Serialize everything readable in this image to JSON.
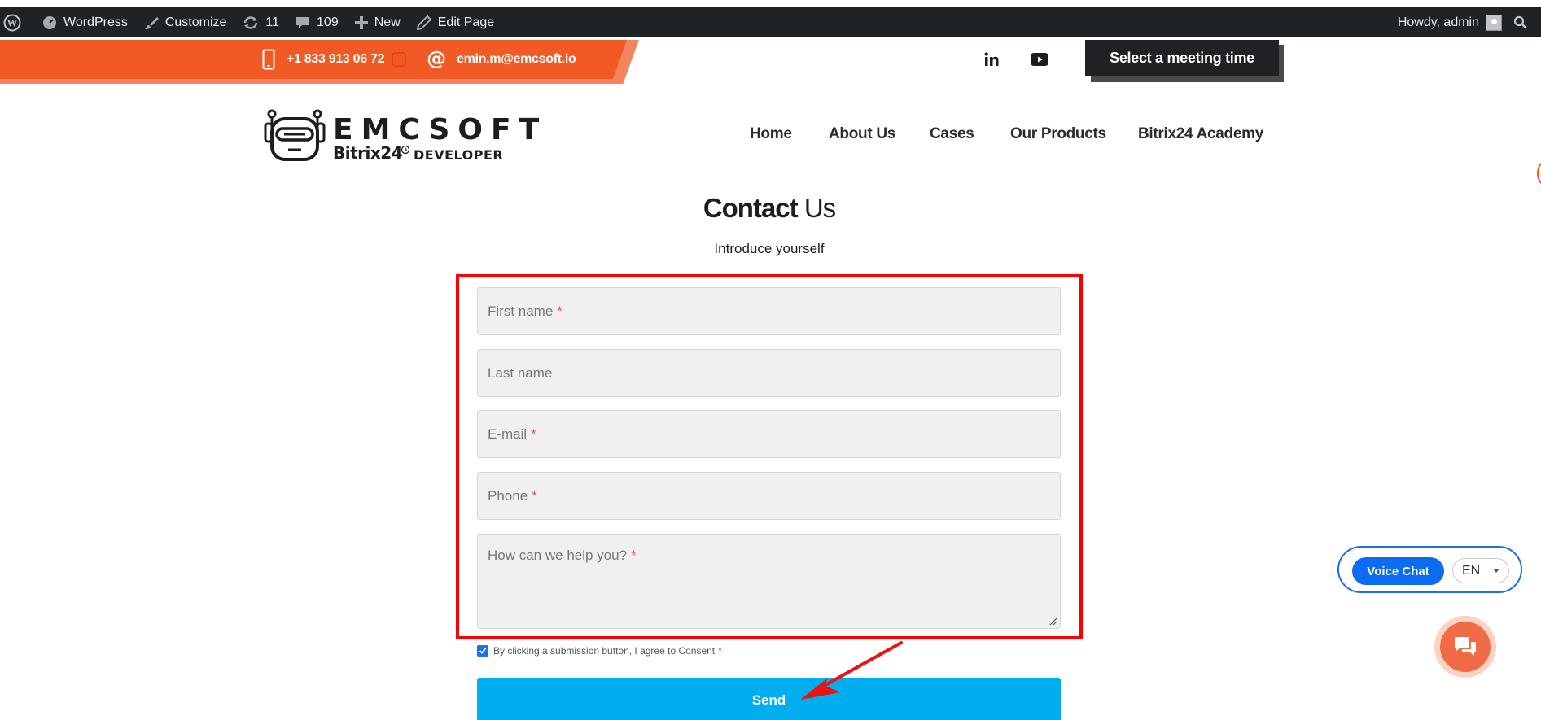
{
  "adminbar": {
    "wordpress": "WordPress",
    "customize": "Customize",
    "updates": "11",
    "comments": "109",
    "new": "New",
    "edit_page": "Edit Page",
    "howdy": "Howdy, admin"
  },
  "topbar": {
    "phone": "+1 833 913 06 72",
    "email": "emin.m@emcsoft.io",
    "meeting_button": "Select a meeting time"
  },
  "logo": {
    "word": "EMCSOFT",
    "bitrix": "Bitrix24",
    "developer": "DEVELOPER"
  },
  "nav": {
    "items": [
      "Home",
      "About Us",
      "Cases",
      "Our Products",
      "Bitrix24 Academy"
    ]
  },
  "page": {
    "title_bold": "Contact",
    "title_light": "Us",
    "subtitle": "Introduce yourself"
  },
  "form": {
    "first_name": "First name",
    "last_name": "Last name",
    "email": "E-mail",
    "phone": "Phone",
    "message": "How can we help you?",
    "required_mark": "*",
    "consent": "By clicking a submission button, I agree to Consent",
    "consent_checked": true,
    "send": "Send"
  },
  "widgets": {
    "voice_chat": "Voice Chat",
    "language": "EN"
  },
  "colors": {
    "brand_orange": "#f15a24",
    "send_blue": "#00adef",
    "highlight_red": "#ff0000",
    "admin_bar": "#1d2327"
  }
}
